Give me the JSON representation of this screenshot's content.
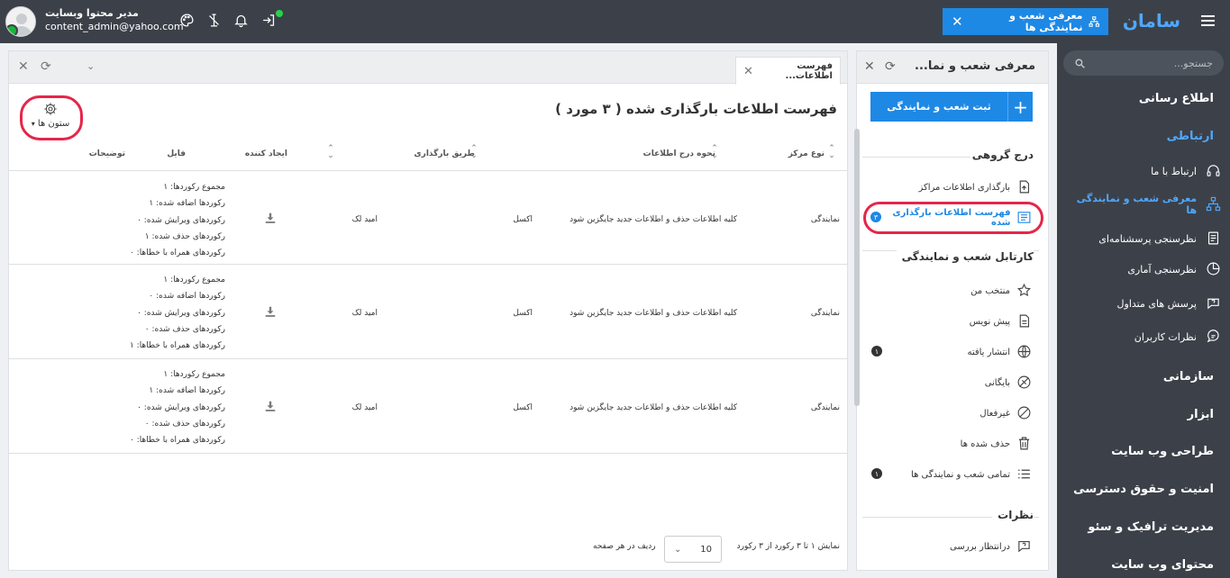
{
  "topbar": {
    "user_name": "مدیر محتوا وبسایت",
    "user_email": "content_admin@yahoo.com",
    "open_tab": "معرفی شعب و نمایندگی ها",
    "brand": "سامان",
    "icons": [
      "palette-icon",
      "notifications-off-icon",
      "bell-icon",
      "login-icon"
    ]
  },
  "sidebar": {
    "search_placeholder": "جستجو...",
    "sections": {
      "notify": "اطلاع رسانی",
      "communication": "ارتباطی",
      "organization": "سازمانی",
      "tools": "ابزار",
      "web_design": "طراحی وب سایت",
      "security": "امنیت و حقوق دسترسی",
      "traffic": "مدیریت ترافیک و سئو",
      "content": "محتوای وب سایت"
    },
    "items": [
      {
        "label": "ارتباط با ما"
      },
      {
        "label": "معرفی شعب و نمایندگی ها"
      },
      {
        "label": "نظرسنجی پرسشنامه‌ای"
      },
      {
        "label": "نظرسنجی آماری"
      },
      {
        "label": "پرسش های متداول"
      },
      {
        "label": "نظرات کاربران"
      }
    ]
  },
  "midpanel": {
    "title": "معرفی شعب و نما...",
    "register_button": "ثبت شعب و نمایندگی",
    "group_insert": "درج گروهی",
    "upload_centers": "بارگذاری اطلاعات مراکز",
    "uploaded_list": "فهرست اطلاعات بارگذاری شده",
    "uploaded_count": "۳",
    "cartable": "کارتابل شعب و نمایندگی",
    "items": [
      {
        "label": "منتخب من"
      },
      {
        "label": "پیش نویس"
      },
      {
        "label": "انتشار یافته",
        "count": "۱"
      },
      {
        "label": "بایگانی"
      },
      {
        "label": "غیرفعال"
      },
      {
        "label": "حذف شده ها"
      },
      {
        "label": "تمامی شعب و نمایندگی ها",
        "count": "۱"
      }
    ],
    "comments": "نظرات",
    "pending": "درانتظار بررسی"
  },
  "main": {
    "tab_label": "فهرست اطلاعات...",
    "title": "فهرست اطلاعات بارگذاری شده ( ۳ مورد )",
    "columns_button": "ستون ها",
    "headers": {
      "center_type": "نوع مرکز",
      "insert_method": "نحوه درج اطلاعات",
      "upload_method": "طریق بارگذاری",
      "creator": "ایجاد کننده",
      "file": "فایل",
      "description": "توضیحات"
    },
    "rows": [
      {
        "center_type": "نمایندگی",
        "insert_method": "کلیه اطلاعات حذف و اطلاعات جدید جایگزین شود",
        "upload_method": "اکسل",
        "creator": "امید لک",
        "stats": [
          "مجموع رکوردها: ۱",
          "رکوردها اضافه شده: ۱",
          "رکوردهای ویرایش شده: ۰",
          "رکوردهای حذف شده: ۱",
          "رکوردهای همراه با خطاها: ۰"
        ]
      },
      {
        "center_type": "نمایندگی",
        "insert_method": "کلیه اطلاعات حذف و اطلاعات جدید جایگزین شود",
        "upload_method": "اکسل",
        "creator": "امید لک",
        "stats": [
          "مجموع رکوردها: ۱",
          "رکوردها اضافه شده: ۰",
          "رکوردهای ویرایش شده: ۰",
          "رکوردهای حذف شده: ۰",
          "رکوردهای همراه با خطاها: ۱"
        ]
      },
      {
        "center_type": "نمایندگی",
        "insert_method": "کلیه اطلاعات حذف و اطلاعات جدید جایگزین شود",
        "upload_method": "اکسل",
        "creator": "امید لک",
        "stats": [
          "مجموع رکوردها: ۱",
          "رکوردها اضافه شده: ۱",
          "رکوردهای ویرایش شده: ۰",
          "رکوردهای حذف شده: ۰",
          "رکوردهای همراه با خطاها: ۰"
        ]
      }
    ],
    "footer": {
      "showing": "نمایش ۱ تا ۳ رکورد از ۳ رکورد",
      "rows_per_page_label": "ردیف در هر صفحه",
      "rows_per_page": "10"
    }
  },
  "colors": {
    "accent": "#1e88e5",
    "sidebar": "#3c4149",
    "highlight": "#e5264a",
    "online": "#18b53a"
  }
}
